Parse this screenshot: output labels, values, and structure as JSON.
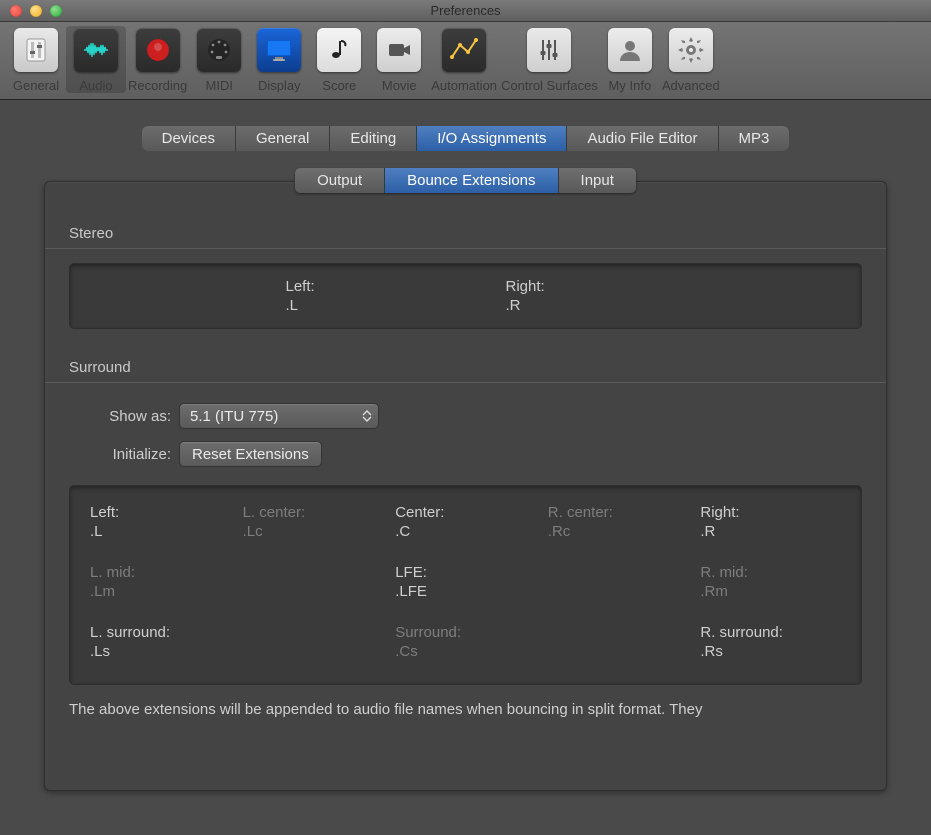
{
  "window": {
    "title": "Preferences"
  },
  "toolbar": {
    "items": [
      {
        "label": "General"
      },
      {
        "label": "Audio"
      },
      {
        "label": "Recording"
      },
      {
        "label": "MIDI"
      },
      {
        "label": "Display"
      },
      {
        "label": "Score"
      },
      {
        "label": "Movie"
      },
      {
        "label": "Automation"
      },
      {
        "label": "Control Surfaces"
      },
      {
        "label": "My Info"
      },
      {
        "label": "Advanced"
      }
    ],
    "selected": "Audio"
  },
  "tabs1": {
    "items": [
      "Devices",
      "General",
      "Editing",
      "I/O Assignments",
      "Audio File Editor",
      "MP3"
    ],
    "selected": "I/O Assignments"
  },
  "tabs2": {
    "items": [
      "Output",
      "Bounce Extensions",
      "Input"
    ],
    "selected": "Bounce Extensions"
  },
  "stereo": {
    "heading": "Stereo",
    "left": {
      "label": "Left:",
      "value": ".L"
    },
    "right": {
      "label": "Right:",
      "value": ".R"
    }
  },
  "surround": {
    "heading": "Surround",
    "show_as_label": "Show as:",
    "show_as_value": "5.1 (ITU 775)",
    "initialize_label": "Initialize:",
    "reset_button": "Reset Extensions",
    "channels": [
      {
        "label": "Left:",
        "value": ".L",
        "active": true
      },
      {
        "label": "L. center:",
        "value": ".Lc",
        "active": false
      },
      {
        "label": "Center:",
        "value": ".C",
        "active": true
      },
      {
        "label": "R. center:",
        "value": ".Rc",
        "active": false
      },
      {
        "label": "Right:",
        "value": ".R",
        "active": true
      },
      {
        "label": "L. mid:",
        "value": ".Lm",
        "active": false
      },
      {
        "label": "",
        "value": "",
        "active": false
      },
      {
        "label": "LFE:",
        "value": ".LFE",
        "active": true
      },
      {
        "label": "",
        "value": "",
        "active": false
      },
      {
        "label": "R. mid:",
        "value": ".Rm",
        "active": false
      },
      {
        "label": "L. surround:",
        "value": ".Ls",
        "active": true
      },
      {
        "label": "",
        "value": "",
        "active": false
      },
      {
        "label": "Surround:",
        "value": ".Cs",
        "active": false
      },
      {
        "label": "",
        "value": "",
        "active": false
      },
      {
        "label": "R. surround:",
        "value": ".Rs",
        "active": true
      }
    ]
  },
  "footnote": "The above extensions will be appended to audio file names when bouncing in split format. They"
}
